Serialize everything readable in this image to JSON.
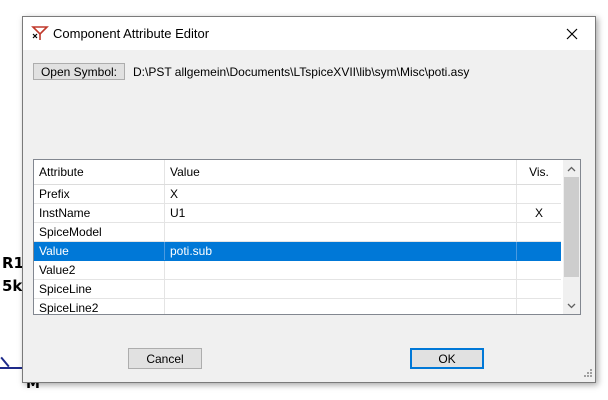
{
  "background": {
    "label_ref": "R1",
    "label_value": "5k",
    "label_node": "M"
  },
  "dialog": {
    "title": "Component Attribute Editor",
    "open_symbol_label": "Open Symbol:",
    "symbol_path": "D:\\PST allgemein\\Documents\\LTspiceXVII\\lib\\sym\\Misc\\poti.asy",
    "table": {
      "headers": [
        "Attribute",
        "Value",
        "Vis."
      ],
      "rows": [
        {
          "attribute": "Prefix",
          "value": "X",
          "vis": ""
        },
        {
          "attribute": "InstName",
          "value": "U1",
          "vis": "X"
        },
        {
          "attribute": "SpiceModel",
          "value": "",
          "vis": ""
        },
        {
          "attribute": "Value",
          "value": "poti.sub",
          "vis": ""
        },
        {
          "attribute": "Value2",
          "value": "",
          "vis": ""
        },
        {
          "attribute": "SpiceLine",
          "value": "",
          "vis": ""
        },
        {
          "attribute": "SpiceLine2",
          "value": "",
          "vis": ""
        }
      ],
      "selected_row": 3
    },
    "cancel_label": "Cancel",
    "ok_label": "OK"
  },
  "colors": {
    "selection": "#0078d7",
    "wire": "#1e2a8a",
    "title_icon": "#c0392b"
  }
}
